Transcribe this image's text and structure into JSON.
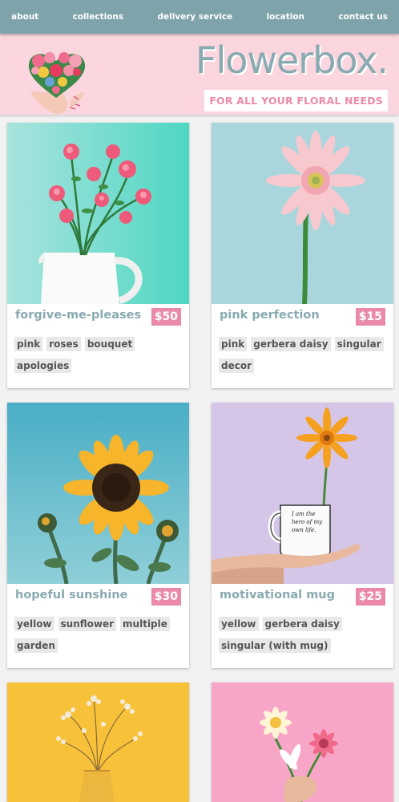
{
  "nav": {
    "items": [
      "about",
      "collections",
      "delivery service",
      "location",
      "contact us"
    ]
  },
  "header": {
    "brand": "Flowerbox.",
    "tagline": "FOR ALL YOUR FLORAL NEEDS"
  },
  "products": [
    {
      "title": "forgive-me-pleases",
      "price": "$50",
      "tags": [
        "pink",
        "roses",
        "bouquet",
        "apologies"
      ]
    },
    {
      "title": "pink perfection",
      "price": "$15",
      "tags": [
        "pink",
        "gerbera daisy",
        "singular",
        "decor"
      ]
    },
    {
      "title": "hopeful sunshine",
      "price": "$30",
      "tags": [
        "yellow",
        "sunflower",
        "multiple",
        "garden"
      ]
    },
    {
      "title": "motivational mug",
      "price": "$25",
      "tags": [
        "yellow",
        "gerbera daisy",
        "singular (with mug)"
      ]
    }
  ],
  "mug_text": "I am the hero of my own life.",
  "colors": {
    "nav": "#7fa3aa",
    "header": "#fcd6df",
    "accent": "#ea8aa8",
    "title": "#88aab0"
  }
}
